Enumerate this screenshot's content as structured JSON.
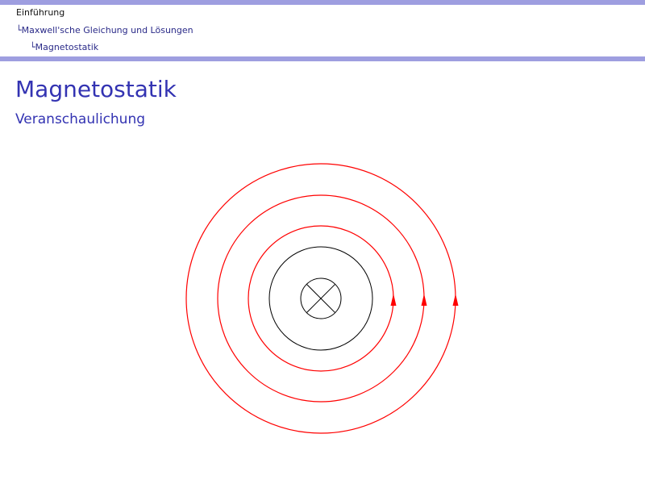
{
  "breadcrumb": {
    "level1": "Einführung",
    "level2": "Maxwell'sche Gleichung und Lösungen",
    "level3": "Magnetostatik",
    "connector": "└"
  },
  "slide": {
    "title": "Magnetostatik",
    "subtitle": "Veranschaulichung"
  },
  "colors": {
    "accent_bar": "#9e9ee0",
    "title": "#3333b2",
    "field_lines": "#ff0000",
    "conductor": "#000000"
  },
  "diagram": {
    "conductor": "current-into-page-symbol",
    "field_line_count": 3,
    "field_direction": "counterclockwise"
  }
}
